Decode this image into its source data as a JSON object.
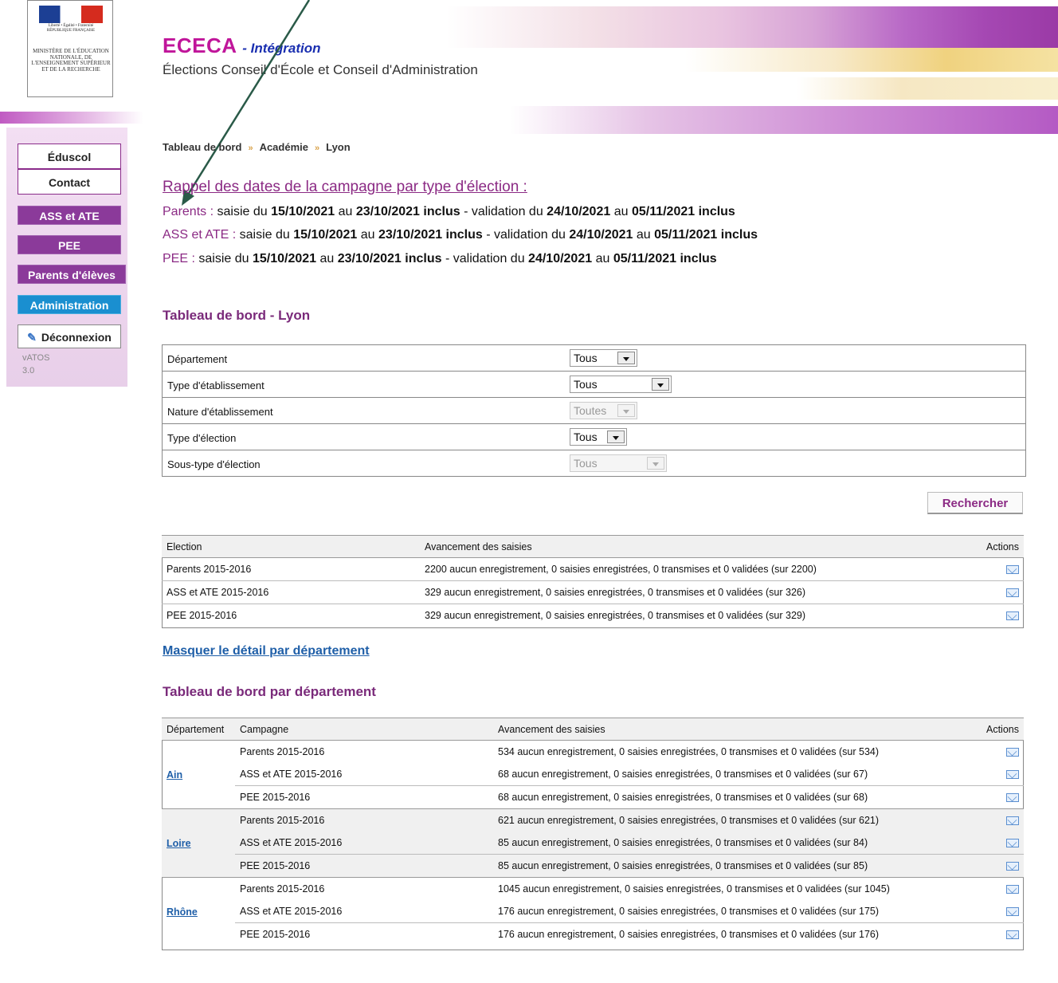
{
  "header": {
    "logo_text_top": "Liberté • Égalité • Fraternité RÉPUBLIQUE FRANÇAISE",
    "ministry": "MINISTÈRE DE L'ÉDUCATION NATIONALE, DE L'ENSEIGNEMENT SUPÉRIEUR ET DE LA RECHERCHE",
    "app_name": "ECECA",
    "app_suffix": "- Intégration",
    "subtitle": "Élections Conseil d'École et Conseil d'Administration"
  },
  "sidebar": {
    "items": [
      {
        "label": "Éduscol"
      },
      {
        "label": "Contact"
      },
      {
        "label": "ASS et ATE"
      },
      {
        "label": "PEE"
      },
      {
        "label": "Parents d'élèves"
      },
      {
        "label": "Administration"
      },
      {
        "label": "Déconnexion"
      }
    ],
    "version_name": "vATOS",
    "version_number": "3.0"
  },
  "breadcrumb": [
    "Tableau de bord",
    "Académie",
    "Lyon"
  ],
  "campaign": {
    "title": "Rappel des dates de la campagne par type d'élection :",
    "lines": [
      {
        "label": "Parents :",
        "t1": "saisie du",
        "d1": "15/10/2021",
        "t2": "au",
        "d2": "23/10/2021 inclus",
        "t3": "- validation du",
        "d3": "24/10/2021",
        "t4": "au",
        "d4": "05/11/2021 inclus"
      },
      {
        "label": "ASS et ATE :",
        "t1": "saisie du",
        "d1": "15/10/2021",
        "t2": "au",
        "d2": "23/10/2021 inclus",
        "t3": "- validation du",
        "d3": "24/10/2021",
        "t4": "au",
        "d4": "05/11/2021 inclus"
      },
      {
        "label": "PEE :",
        "t1": "saisie du",
        "d1": "15/10/2021",
        "t2": "au",
        "d2": "23/10/2021 inclus",
        "t3": "- validation du",
        "d3": "24/10/2021",
        "t4": "au",
        "d4": "05/11/2021 inclus"
      }
    ]
  },
  "dashboard": {
    "title": "Tableau de bord - Lyon",
    "filters": [
      {
        "label": "Département",
        "value": "Tous"
      },
      {
        "label": "Type d'établissement",
        "value": "Tous"
      },
      {
        "label": "Nature d'établissement",
        "value": "Toutes"
      },
      {
        "label": "Type d'élection",
        "value": "Tous"
      },
      {
        "label": "Sous-type d'élection",
        "value": "Tous"
      }
    ],
    "search_label": "Rechercher",
    "columns": [
      "Election",
      "Avancement des saisies",
      "Actions"
    ],
    "rows": [
      {
        "election": "Parents 2015-2016",
        "progress": "2200 aucun enregistrement, 0 saisies enregistrées, 0 transmises et 0 validées (sur 2200)"
      },
      {
        "election": "ASS et ATE 2015-2016",
        "progress": "329 aucun enregistrement, 0 saisies enregistrées, 0 transmises et 0 validées (sur 326)"
      },
      {
        "election": "PEE 2015-2016",
        "progress": "329 aucun enregistrement, 0 saisies enregistrées, 0 transmises et 0 validées (sur 329)"
      }
    ]
  },
  "toggle_link": "Masquer le détail par département",
  "by_department": {
    "title": "Tableau de bord par département",
    "columns": [
      "Département",
      "Campagne",
      "Avancement des saisies",
      "Actions"
    ],
    "departments": [
      {
        "name": "Ain",
        "rows": [
          {
            "campaign": "Parents 2015-2016",
            "progress": "534 aucun enregistrement, 0 saisies enregistrées, 0 transmises et 0 validées (sur 534)"
          },
          {
            "campaign": "ASS et ATE 2015-2016",
            "progress": "68 aucun enregistrement, 0 saisies enregistrées, 0 transmises et 0 validées (sur 67)"
          },
          {
            "campaign": "PEE 2015-2016",
            "progress": "68 aucun enregistrement, 0 saisies enregistrées, 0 transmises et 0 validées (sur 68)"
          }
        ]
      },
      {
        "name": "Loire",
        "rows": [
          {
            "campaign": "Parents 2015-2016",
            "progress": "621 aucun enregistrement, 0 saisies enregistrées, 0 transmises et 0 validées (sur 621)"
          },
          {
            "campaign": "ASS et ATE 2015-2016",
            "progress": "85 aucun enregistrement, 0 saisies enregistrées, 0 transmises et 0 validées (sur 84)"
          },
          {
            "campaign": "PEE 2015-2016",
            "progress": "85 aucun enregistrement, 0 saisies enregistrées, 0 transmises et 0 validées (sur 85)"
          }
        ]
      },
      {
        "name": "Rhône",
        "rows": [
          {
            "campaign": "Parents 2015-2016",
            "progress": "1045 aucun enregistrement, 0 saisies enregistrées, 0 transmises et 0 validées (sur 1045)"
          },
          {
            "campaign": "ASS et ATE 2015-2016",
            "progress": "176 aucun enregistrement, 0 saisies enregistrées, 0 transmises et 0 validées (sur 175)"
          },
          {
            "campaign": "PEE 2015-2016",
            "progress": "176 aucun enregistrement, 0 saisies enregistrées, 0 transmises et 0 validées (sur 176)"
          }
        ]
      }
    ]
  },
  "colors": {
    "brand_magenta": "#c0159a",
    "section_purple": "#7a2a7a",
    "link_blue": "#1f5fa8",
    "nav_purple": "#8b3a9a",
    "nav_blue": "#1a8fd0"
  },
  "icons": {
    "mail": "envelope-icon",
    "logout": "pen-icon",
    "breadcrumb_sep": "double-chevron-icon",
    "select": "dropdown-arrow-icon"
  }
}
